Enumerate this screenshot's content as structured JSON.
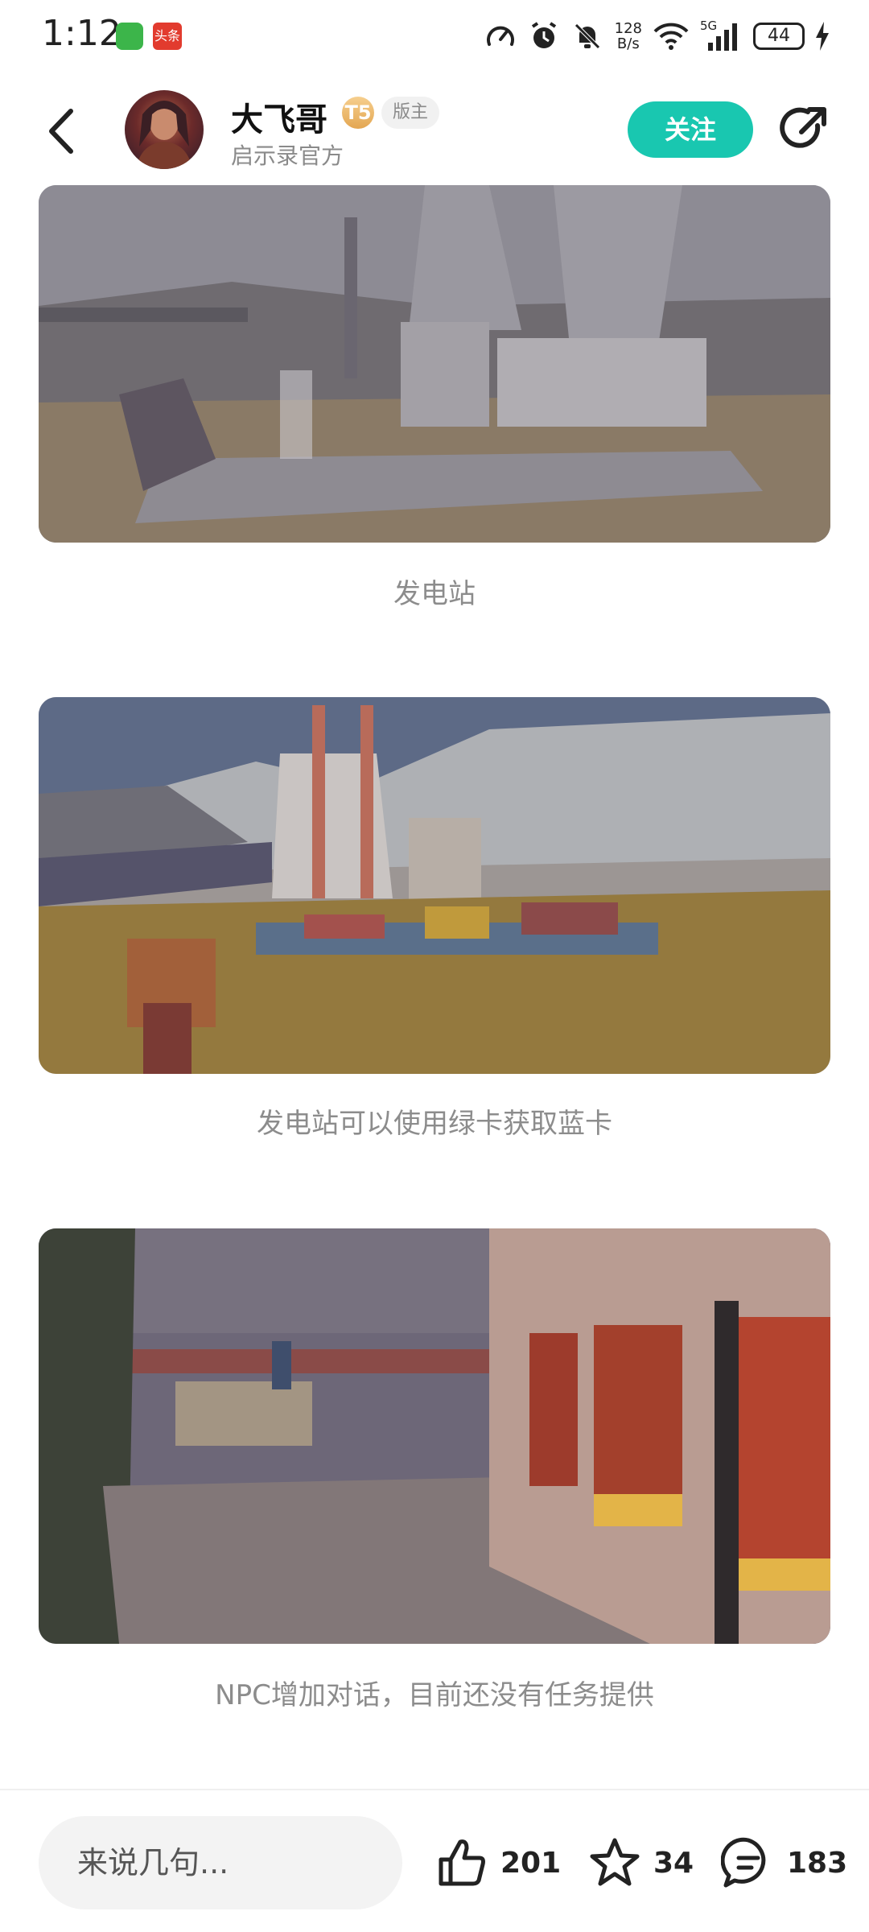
{
  "status_bar": {
    "time": "1:12",
    "app_badge_text": "头条",
    "net_speed_value": "128",
    "net_speed_unit": "B/s",
    "network_type": "5G",
    "battery_level": "44"
  },
  "header": {
    "user_name": "大飞哥",
    "level_badge": "T5",
    "role_badge": "版主",
    "subtitle": "启示录官方",
    "follow_label": "关注"
  },
  "posts": [
    {
      "image_alt": "power plant scene",
      "caption": "发电站"
    },
    {
      "image_alt": "power plant with containers",
      "caption": "发电站可以使用绿卡获取蓝卡"
    },
    {
      "image_alt": "NPC reception room",
      "caption": "NPC增加对话，目前还没有任务提供"
    }
  ],
  "bottom_bar": {
    "comment_placeholder": "来说几句...",
    "like_count": "201",
    "favorite_count": "34",
    "comment_count": "183"
  },
  "colors": {
    "accent": "#19c7b0",
    "caption_text": "#8c8c8c",
    "input_bg": "#f3f3f3"
  }
}
